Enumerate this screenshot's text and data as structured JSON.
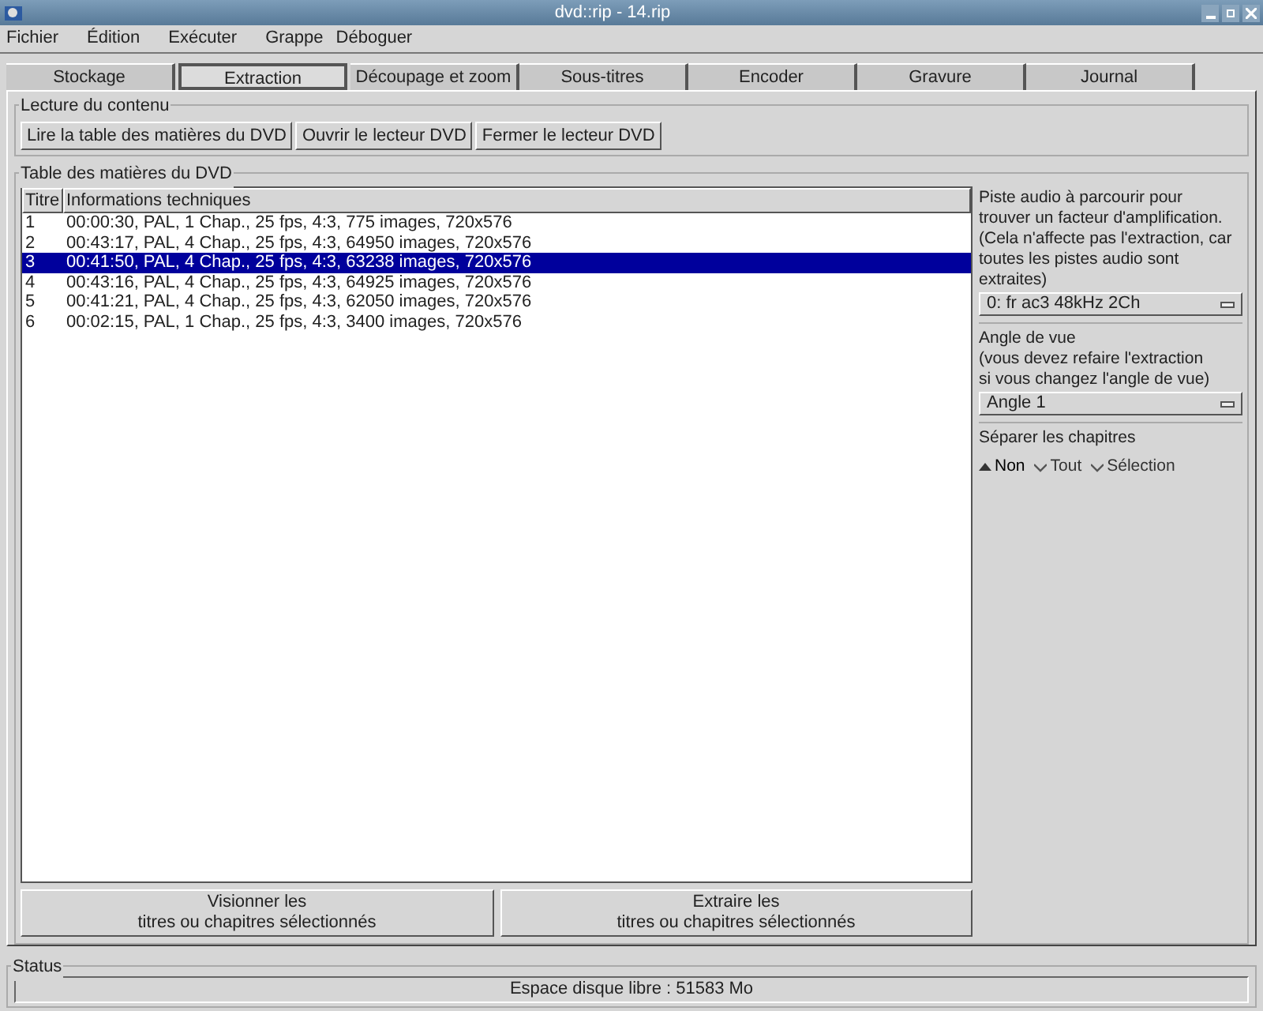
{
  "window": {
    "title": "dvd::rip - 14.rip"
  },
  "menu": [
    "Fichier",
    "Édition",
    "Exécuter",
    "Grappe",
    "Déboguer"
  ],
  "tabs": [
    {
      "label": "Stockage",
      "selected": false
    },
    {
      "label": "Extraction",
      "selected": true
    },
    {
      "label": "Découpage et zoom",
      "selected": false
    },
    {
      "label": "Sous-titres",
      "selected": false
    },
    {
      "label": "Encoder",
      "selected": false
    },
    {
      "label": "Gravure",
      "selected": false
    },
    {
      "label": "Journal",
      "selected": false
    }
  ],
  "content_reading": {
    "title": "Lecture du contenu",
    "buttons": [
      "Lire la table des matières du DVD",
      "Ouvrir le lecteur DVD",
      "Fermer le lecteur DVD"
    ]
  },
  "toc": {
    "title": "Table des matières du DVD",
    "columns": [
      "Titre",
      "Informations techniques"
    ],
    "rows": [
      {
        "title": "1",
        "info": "00:00:30, PAL, 1 Chap., 25 fps, 4:3, 775 images, 720x576",
        "selected": false
      },
      {
        "title": "2",
        "info": "00:43:17, PAL, 4 Chap., 25 fps, 4:3, 64950 images, 720x576",
        "selected": false
      },
      {
        "title": "3",
        "info": "00:41:50, PAL, 4 Chap., 25 fps, 4:3, 63238 images, 720x576",
        "selected": true
      },
      {
        "title": "4",
        "info": "00:43:16, PAL, 4 Chap., 25 fps, 4:3, 64925 images, 720x576",
        "selected": false
      },
      {
        "title": "5",
        "info": "00:41:21, PAL, 4 Chap., 25 fps, 4:3, 62050 images, 720x576",
        "selected": false
      },
      {
        "title": "6",
        "info": "00:02:15, PAL, 1 Chap., 25 fps, 4:3, 3400 images, 720x576",
        "selected": false
      }
    ],
    "buttons": [
      "Visionner les\ntitres ou chapitres sélectionnés",
      "Extraire les\ntitres ou chapitres sélectionnés"
    ]
  },
  "side": {
    "audio_label": "Piste audio à parcourir pour\ntrouver un facteur d'amplification.\n(Cela n'affecte pas l'extraction, car\ntoutes les pistes audio sont extraites)",
    "audio_value": "0: fr ac3 48kHz 2Ch",
    "angle_label": "Angle de vue\n(vous devez refaire l'extraction\nsi vous changez l'angle de vue)",
    "angle_value": "Angle 1",
    "split_label": "Séparer les chapitres",
    "split_options": [
      {
        "label": "Non",
        "selected": true
      },
      {
        "label": "Tout",
        "selected": false
      },
      {
        "label": "Sélection",
        "selected": false
      }
    ]
  },
  "status": {
    "title": "Status",
    "text": "Espace disque libre : 51583 Mo"
  }
}
